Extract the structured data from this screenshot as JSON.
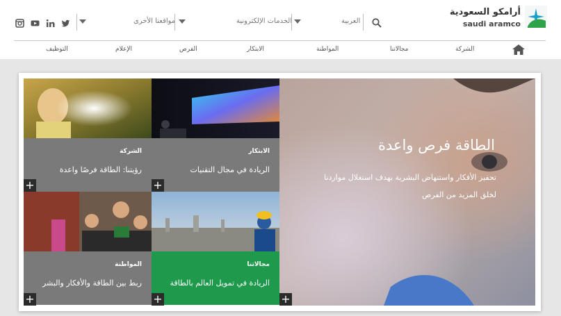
{
  "brand": {
    "name_ar": "أرامكو السعودية",
    "name_en": "saudi aramco",
    "accent": "#1f9a4c"
  },
  "social": [
    "instagram-icon",
    "youtube-icon",
    "linkedin-icon",
    "twitter-icon"
  ],
  "topbar": {
    "other_sites": "مواقعنا الأخرى",
    "eservices": "الخدمات الإلكترونية",
    "language": "العربية"
  },
  "nav": {
    "items": [
      "الشركة",
      "مجالاتنا",
      "المواطنة",
      "الابتكار",
      "الفرص",
      "الإعلام",
      "التوظيف"
    ]
  },
  "tiles": [
    {
      "category": "الشركة",
      "title": "رؤيتنا: الطاقة فرصًا واعدة"
    },
    {
      "category": "الابتكار",
      "title": "الريادة في مجال التقنيات"
    },
    {
      "category": "المواطنة",
      "title": "ربط بين الطاقة والأفكار والبشر"
    },
    {
      "category": "مجالاتنا",
      "title": "الريادة في تمويل العالم بالطاقة"
    }
  ],
  "hero": {
    "title": "الطاقة فرص واعدة",
    "text": "تحفيز الأفكار واستنهاض البشرية بهدف استغلال مواردنا لخلق المزيد من الفرص"
  },
  "plus_symbol": "+"
}
